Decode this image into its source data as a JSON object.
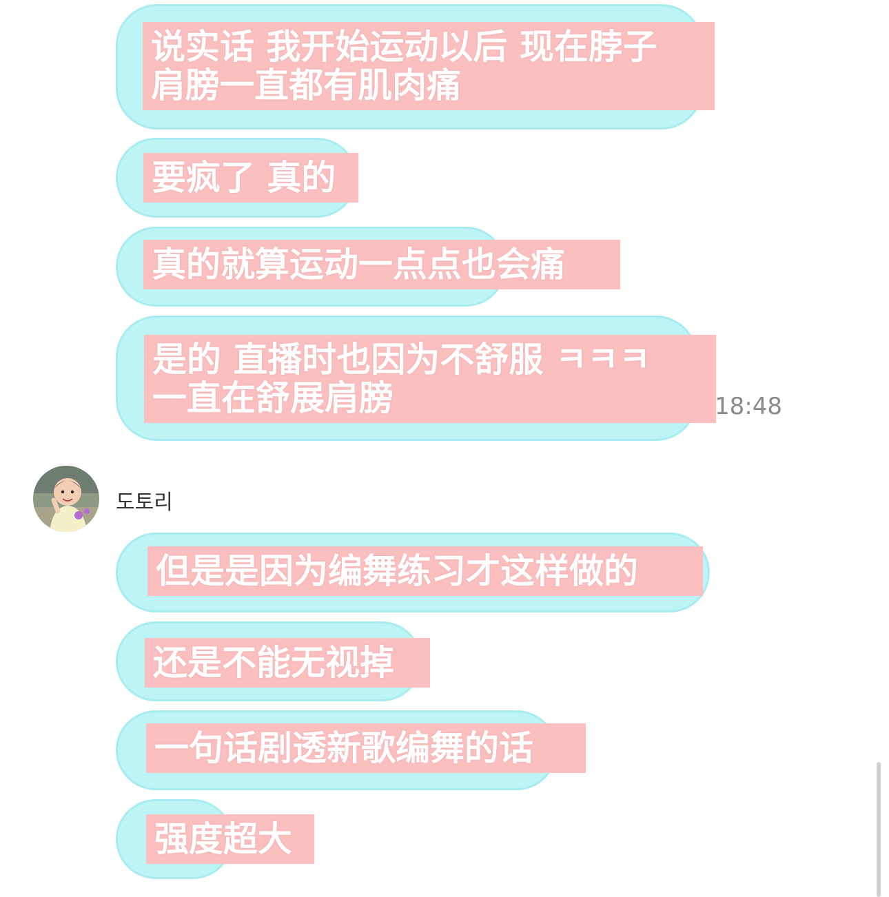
{
  "messages_before": [
    {
      "lines": [
        "说实话 我开始运动以后 现在脖子",
        "肩膀一直都有肌肉痛"
      ]
    },
    {
      "lines": [
        "要疯了 真的"
      ]
    },
    {
      "lines": [
        "真的就算运动一点点也会痛"
      ]
    },
    {
      "lines": [
        "是的 直播时也因为不舒服 ㅋㅋㅋ",
        "一直在舒展肩膀"
      ]
    }
  ],
  "timestamp": "18:48",
  "sender": {
    "name": "도토리"
  },
  "messages_after": [
    {
      "lines": [
        "但是是因为编舞练习才这样做的"
      ]
    },
    {
      "lines": [
        "还是不能无视掉"
      ]
    },
    {
      "lines": [
        "一句话剧透新歌编舞的话"
      ]
    },
    {
      "lines": [
        "强度超大"
      ]
    }
  ],
  "colors": {
    "bubble": "#bdf4f5",
    "bubble_border": "#a9ecef",
    "subtitle_bg": "#fbbfc0",
    "subtitle_text": "#ffffff",
    "timestamp": "#8a8a8a"
  }
}
